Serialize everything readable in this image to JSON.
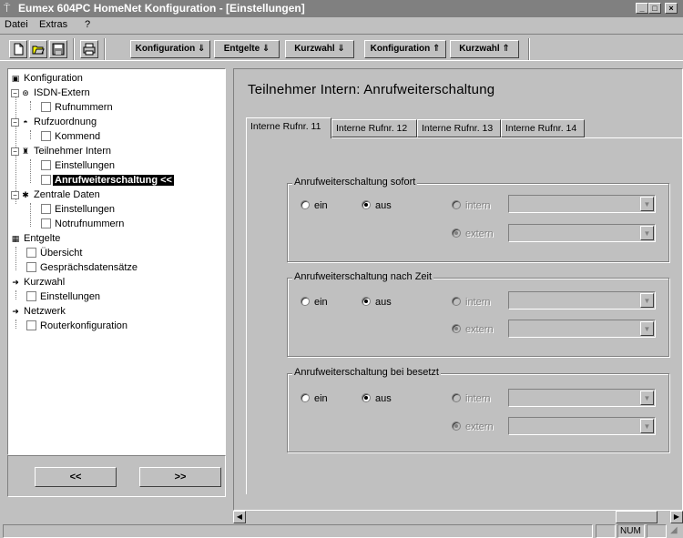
{
  "window": {
    "title": "Eumex 604PC HomeNet Konfiguration - [Einstellungen]",
    "min_label": "_",
    "max_label": "□",
    "close_label": "×"
  },
  "menu": {
    "items": [
      "Datei",
      "Extras",
      "?"
    ]
  },
  "toolbar": {
    "nav_buttons": [
      "Konfiguration ⇓",
      "Entgelte ⇓",
      "Kurzwahl ⇓",
      "Konfiguration ⇑",
      "Kurzwahl ⇑"
    ]
  },
  "tree": {
    "items": [
      {
        "label": "Konfiguration",
        "icon": "gear-icon",
        "glyph": "▣"
      },
      {
        "label": "ISDN-Extern",
        "icon": "isdn-icon",
        "glyph": "⊛"
      },
      {
        "label": "Rufnummern"
      },
      {
        "label": "Rufzuordnung",
        "icon": "phone-icon",
        "glyph": "◓"
      },
      {
        "label": "Kommend"
      },
      {
        "label": "Teilnehmer Intern",
        "icon": "user-icon",
        "glyph": "♜"
      },
      {
        "label": "Einstellungen"
      },
      {
        "label": "Anrufweiterschaltung <<"
      },
      {
        "label": "Zentrale Daten",
        "icon": "star-icon",
        "glyph": "✱"
      },
      {
        "label": "Einstellungen"
      },
      {
        "label": "Notrufnummern"
      },
      {
        "label": "Entgelte",
        "icon": "billing-icon",
        "glyph": "▦"
      },
      {
        "label": "Übersicht"
      },
      {
        "label": "Gesprächsdatensätze"
      },
      {
        "label": "Kurzwahl",
        "icon": "arrow-icon",
        "glyph": "➜"
      },
      {
        "label": "Einstellungen"
      },
      {
        "label": "Netzwerk",
        "icon": "arrow-icon",
        "glyph": "➜"
      },
      {
        "label": "Routerkonfiguration"
      }
    ],
    "prev_button": "<<",
    "next_button": ">>"
  },
  "content": {
    "title": "Teilnehmer Intern: Anrufweiterschaltung",
    "tabs": [
      "Interne Rufnr. 11",
      "Interne Rufnr. 12",
      "Interne Rufnr. 13",
      "Interne Rufnr. 14"
    ],
    "groups": [
      {
        "label": "Anrufweiterschaltung sofort",
        "on": "ein",
        "off": "aus",
        "intern": "intern",
        "extern": "extern"
      },
      {
        "label": "Anrufweiterschaltung nach Zeit",
        "on": "ein",
        "off": "aus",
        "intern": "intern",
        "extern": "extern"
      },
      {
        "label": "Anrufweiterschaltung bei besetzt",
        "on": "ein",
        "off": "aus",
        "intern": "intern",
        "extern": "extern"
      }
    ]
  },
  "status": {
    "num": "NUM"
  }
}
